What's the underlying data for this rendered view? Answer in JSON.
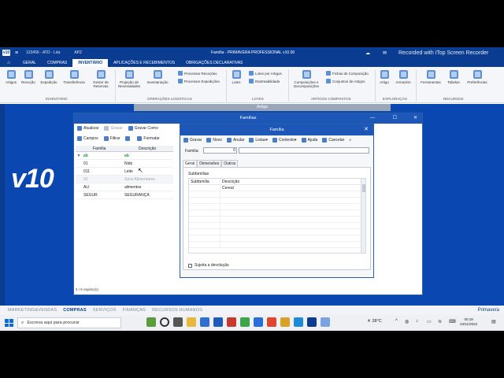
{
  "titlebar": {
    "logo": "v10",
    "company": "123456 - ATD - Lda",
    "apz": "APZ",
    "app_title": "Família - PRIMAVERA PROFESSIONAL v10.00",
    "recorder": "Recorded with iTop Screen Recorder"
  },
  "ribbon_tabs": [
    "GERAL",
    "COMPRAS",
    "INVENTÁRIO",
    "APLICAÇÕES E RECEBIMENTOS",
    "OBRIGAÇÕES DECLARATIVAS"
  ],
  "ribbon": {
    "inventario": [
      "Artigos",
      "Receção",
      "Expedição",
      "Transferência",
      "Gestor de Reservas"
    ],
    "operacoes": [
      "Projeção de Necessidades",
      "Inventariação"
    ],
    "operacoes_small": [
      "Processar Receções",
      "Processar Expedições"
    ],
    "lotes": [
      "Lotes"
    ],
    "lotes_small": [
      "Lotes por Artigos",
      "Rastreabilidade"
    ],
    "compostos": [
      "Composições e Decomposições"
    ],
    "compostos_small": [
      "Fichas de Composição",
      "Conjuntos de Artigos"
    ],
    "exploracao": [
      "Artigo",
      "Armazém"
    ],
    "recursos": [
      "Ferramentas",
      "Tabelas",
      "Preferências"
    ],
    "groups": [
      "INVENTÁRIO",
      "OPERAÇÕES LOGÍSTICAS",
      "LOTES",
      "ARTIGOS COMPOSTOS",
      "EXPLORAÇÃO",
      "RECURSOS"
    ]
  },
  "artigo_strip": "Artigo",
  "brand": "v10",
  "familias_window": {
    "title": "Famílias",
    "toolbar1": [
      "Atualizar",
      "Gravar",
      "Gravar Como"
    ],
    "toolbar2": [
      "Campos",
      "Filtrar",
      "Formatar"
    ],
    "columns": [
      "Família",
      "Descrição"
    ],
    "rows": [
      {
        "familia": "01",
        "descricao": "Nido",
        "gray": false
      },
      {
        "familia": "011",
        "descricao": "Leite",
        "gray": false
      },
      {
        "familia": "02",
        "descricao": "Sens Alimentares",
        "gray": true
      },
      {
        "familia": "ALI",
        "descricao": "alimentos",
        "gray": false
      },
      {
        "familia": "SEGUR",
        "descricao": "SEGURANÇA",
        "gray": false
      }
    ],
    "status": "5 / 5 registo(s)."
  },
  "familia_window": {
    "title": "Família",
    "toolbar": [
      "Gravar",
      "Novo",
      "Anular",
      "Listas",
      "Contexto",
      "Ajuda",
      "Cancelar"
    ],
    "field_label": "Família:",
    "field_value": "0",
    "tabs": [
      "Geral",
      "Dimensões",
      "Outros"
    ],
    "subfamilias_title": "Subfamílias",
    "sub_columns": [
      "Subfamília",
      "Descrição"
    ],
    "sub_rows": [
      {
        "subfamilia": "",
        "descricao": "Cereal"
      }
    ],
    "checkbox_label": "Sujeita a devolução"
  },
  "modules": [
    "MARKETING&VENDAS",
    "COMPRAS",
    "SERVIÇOS",
    "FINANÇAS",
    "RECURSOS HUMANOS"
  ],
  "active_module": "COMPRAS",
  "primavera_brand": "Primavera",
  "taskbar": {
    "search_placeholder": "Escreva aqui para procurar",
    "weather": "28°C",
    "time": "00:18",
    "date": "23/11/2022"
  }
}
